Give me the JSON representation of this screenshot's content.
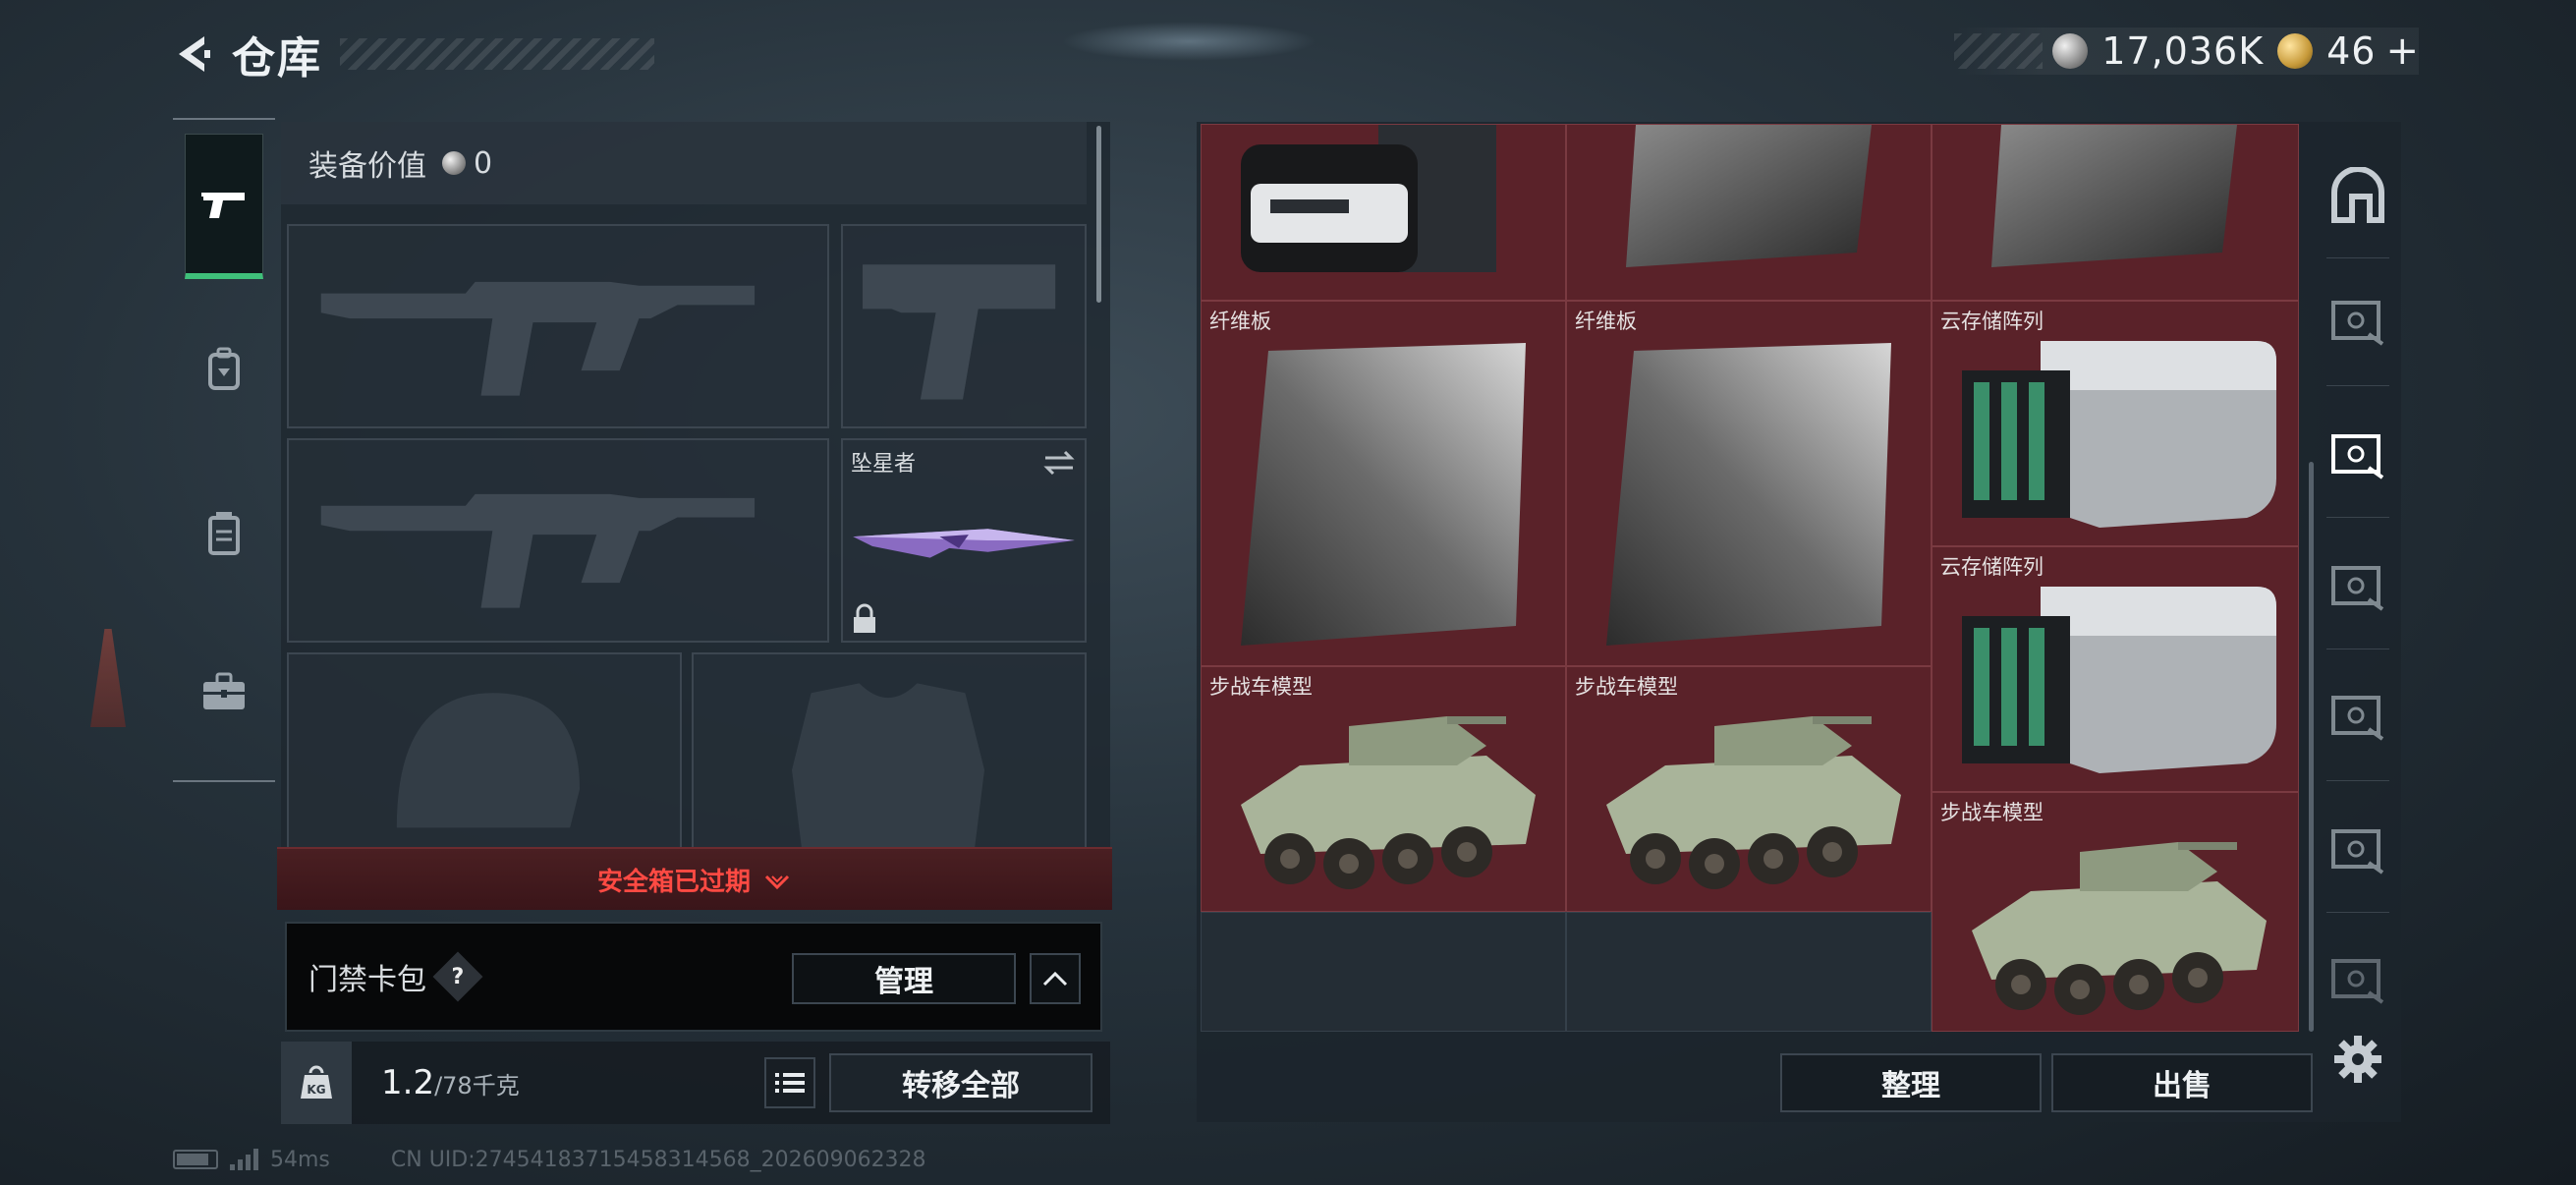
{
  "header": {
    "title": "仓库",
    "currency": {
      "silver_value": "17,036K",
      "gold_value": "46",
      "gold_plus": "+",
      "silver_icon": "silver-coin-icon",
      "gold_icon": "gold-coin-icon"
    }
  },
  "left_nav": {
    "items": [
      {
        "name": "weapons",
        "icon": "pistol-icon",
        "active": true
      },
      {
        "name": "gear",
        "icon": "backpack-icon",
        "active": false
      },
      {
        "name": "consumables",
        "icon": "container-icon",
        "active": false
      },
      {
        "name": "briefcase",
        "icon": "briefcase-icon",
        "active": false
      }
    ]
  },
  "equipment": {
    "value_label": "装备价值",
    "value": "0",
    "slots": {
      "primary_weapon": {
        "icon": "rifle-silhouette-icon"
      },
      "secondary_weapon": {
        "icon": "pistol-silhouette-icon"
      },
      "primary_weapon_2": {
        "icon": "rifle-silhouette-icon"
      },
      "melee": {
        "label": "坠星者",
        "icon": "knife-icon",
        "locked": true
      },
      "helmet": {
        "icon": "helmet-silhouette-icon"
      },
      "armor": {
        "icon": "vest-silhouette-icon"
      }
    },
    "safe_box_status": "安全箱已过期",
    "card_pack": {
      "title": "门禁卡包",
      "help": "?",
      "manage_label": "管理"
    },
    "weight": {
      "current": "1.2",
      "max": "/78千克",
      "unit_icon": "kg-weight-icon"
    },
    "transfer_all_label": "转移全部"
  },
  "storage": {
    "items": [
      {
        "id": "c1",
        "label": "",
        "kind": "device"
      },
      {
        "id": "c2",
        "label": "",
        "kind": "fiberboard"
      },
      {
        "id": "c3",
        "label": "",
        "kind": "fiberboard"
      },
      {
        "id": "c4",
        "label": "纤维板",
        "kind": "fiberboard"
      },
      {
        "id": "c5",
        "label": "纤维板",
        "kind": "fiberboard"
      },
      {
        "id": "c6",
        "label": "云存储阵列",
        "kind": "storage-array"
      },
      {
        "id": "c7",
        "label": "云存储阵列",
        "kind": "storage-array"
      },
      {
        "id": "c8",
        "label": "步战车模型",
        "kind": "ifv-model"
      },
      {
        "id": "c9",
        "label": "步战车模型",
        "kind": "ifv-model"
      },
      {
        "id": "c10",
        "label": "步战车模型",
        "kind": "ifv-model"
      }
    ],
    "sort_label": "整理",
    "sell_label": "出售"
  },
  "category_bar": {
    "items": [
      {
        "icon": "home-icon"
      },
      {
        "icon": "storage-box-icon"
      },
      {
        "icon": "storage-box-active-icon"
      },
      {
        "icon": "storage-box-icon"
      },
      {
        "icon": "storage-box-icon"
      },
      {
        "icon": "storage-box-icon"
      },
      {
        "icon": "storage-box-icon"
      }
    ],
    "settings_icon": "gear-icon"
  },
  "status_bar": {
    "ping": "54ms",
    "uid": "CN UID:274541837154583145​68_202609062328"
  },
  "colors": {
    "accent_green": "#3fc07a",
    "alert_red": "#ff4a43",
    "item_bg": "#5a2229"
  }
}
